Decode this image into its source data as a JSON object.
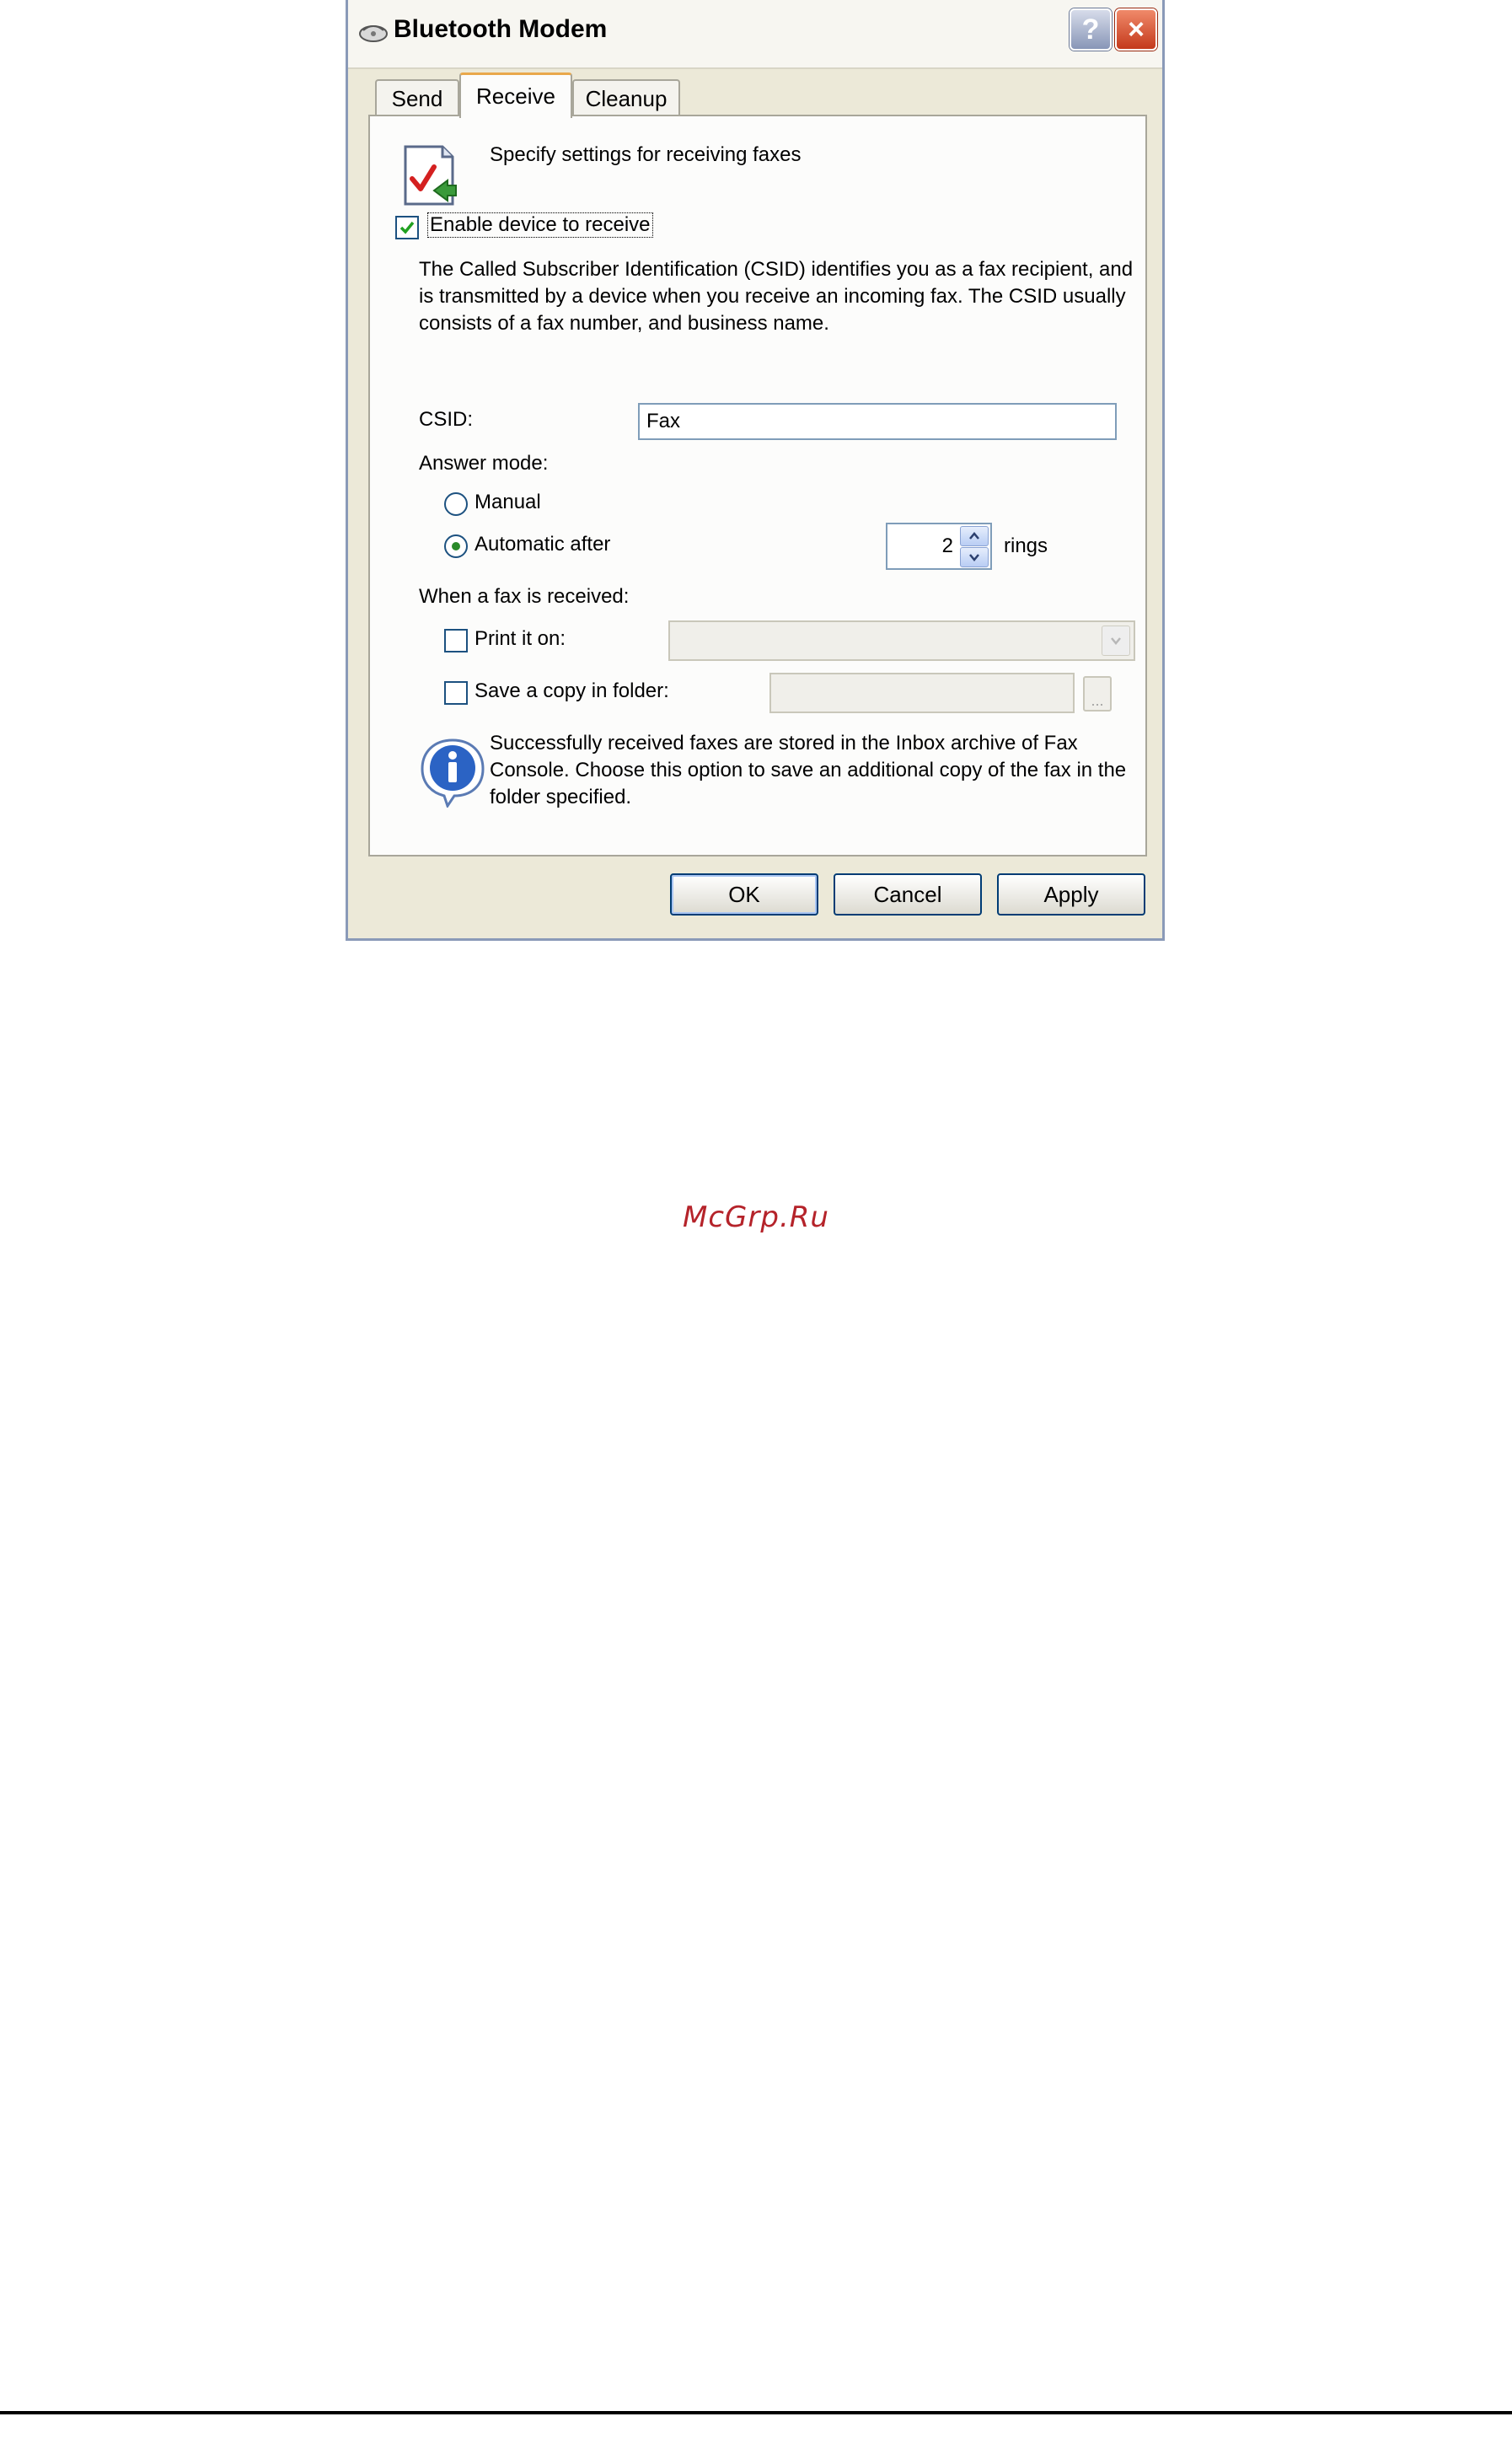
{
  "dialog": {
    "title": "Bluetooth Modem",
    "help_glyph": "?",
    "close_glyph": "×"
  },
  "tabs": [
    {
      "label": "Send",
      "active": false
    },
    {
      "label": "Receive",
      "active": true
    },
    {
      "label": "Cleanup",
      "active": false
    }
  ],
  "receive": {
    "header": "Specify settings for receiving faxes",
    "enable_label": "Enable device to receive",
    "enable_checked": true,
    "csid_description": "The Called Subscriber Identification (CSID) identifies you as a fax recipient, and is transmitted by a device when you receive an incoming fax. The CSID usually consists of a fax number, and business name.",
    "csid_label": "CSID:",
    "csid_value": "Fax",
    "answer_mode_label": "Answer mode:",
    "manual_label": "Manual",
    "manual_selected": false,
    "automatic_label": "Automatic after",
    "automatic_selected": true,
    "rings_value": "2",
    "rings_label": "rings",
    "when_received_label": "When a fax is received:",
    "print_label": "Print it on:",
    "print_checked": false,
    "print_value": "",
    "save_label": "Save a copy in folder:",
    "save_checked": false,
    "folder_value": "",
    "browse_label": "...",
    "info_text": "Successfully received faxes are stored in the Inbox archive of Fax Console. Choose this option to save an additional copy of the fax in the folder specified."
  },
  "buttons": {
    "ok": "OK",
    "cancel": "Cancel",
    "apply": "Apply"
  },
  "watermark": "McGrp.Ru",
  "colors": {
    "dialog_bg": "#ece9d8",
    "panel_bg": "#fcfcfb",
    "active_tab_accent": "#e9a84b",
    "close_button": "#c4391c",
    "watermark": "#b5232a"
  }
}
